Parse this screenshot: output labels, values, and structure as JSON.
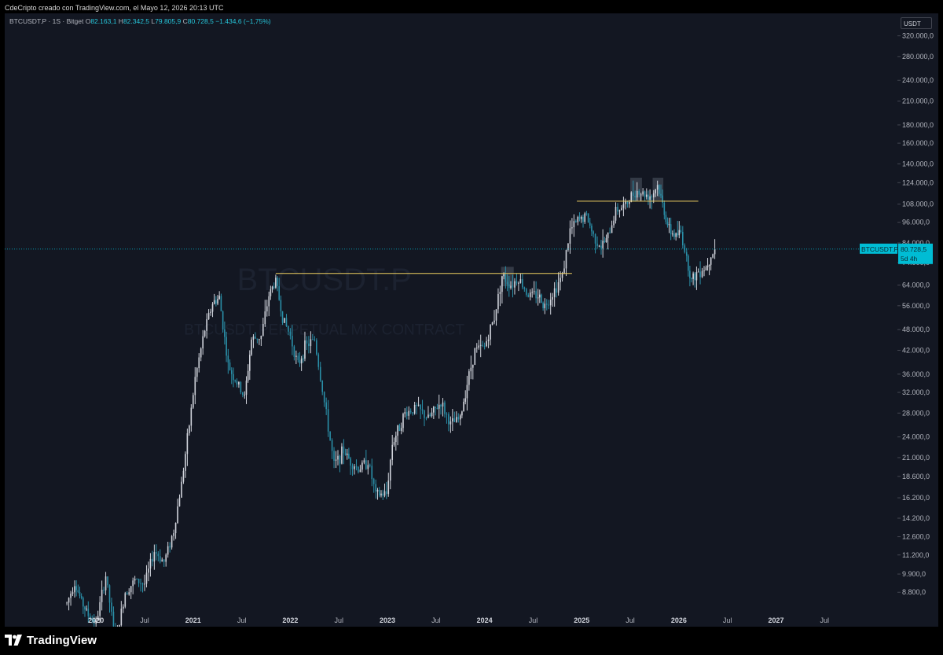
{
  "caption": "CdeCripto creado con TradingView.com, el Mayo 12, 2026 20:13 UTC",
  "legend": {
    "symbol_line": "BTCUSDT.P · 1S · Bitget",
    "open_label": "O",
    "open": "82.163,1",
    "high_label": "H",
    "high": "82.342,5",
    "low_label": "L",
    "low": "79.805,9",
    "close_label": "C",
    "close": "80.728,5",
    "change": "−1.434,6 (−1,75%)"
  },
  "currency": "USDT",
  "watermark": {
    "symbol": "BTCUSDT.P",
    "description": "BTCUSDT PERPETUAL MIX CONTRACT"
  },
  "price_scale": {
    "ticks": [
      "320.000,0",
      "280.000,0",
      "240.000,0",
      "210.000,0",
      "180.000,0",
      "160.000,0",
      "140.000,0",
      "124.000,0",
      "108.000,0",
      "96.000,0",
      "84.000,0",
      "74.000,0",
      "64.000,0",
      "56.000,0",
      "48.000,0",
      "42.000,0",
      "36.000,0",
      "32.000,0",
      "28.000,0",
      "24.000,0",
      "21.000,0",
      "18.600,0",
      "16.200,0",
      "14.200,0",
      "12.600,0",
      "11.200,0",
      "9.900,0",
      "8.800,0"
    ],
    "tick_values": [
      320000,
      280000,
      240000,
      210000,
      180000,
      160000,
      140000,
      124000,
      108000,
      96000,
      84000,
      74000,
      64000,
      56000,
      48000,
      42000,
      36000,
      32000,
      28000,
      24000,
      21000,
      18600,
      16200,
      14200,
      12600,
      11200,
      9900,
      8800
    ],
    "scale": "log",
    "range": [
      7800,
      370000
    ]
  },
  "time_scale": {
    "ticks": [
      {
        "label": "2020",
        "t": 2020.0,
        "year": true
      },
      {
        "label": "Jul",
        "t": 2020.5,
        "year": false
      },
      {
        "label": "2021",
        "t": 2021.0,
        "year": true
      },
      {
        "label": "Jul",
        "t": 2021.5,
        "year": false
      },
      {
        "label": "2022",
        "t": 2022.0,
        "year": true
      },
      {
        "label": "Jul",
        "t": 2022.5,
        "year": false
      },
      {
        "label": "2023",
        "t": 2023.0,
        "year": true
      },
      {
        "label": "Jul",
        "t": 2023.5,
        "year": false
      },
      {
        "label": "2024",
        "t": 2024.0,
        "year": true
      },
      {
        "label": "Jul",
        "t": 2024.5,
        "year": false
      },
      {
        "label": "2025",
        "t": 2025.0,
        "year": true
      },
      {
        "label": "Jul",
        "t": 2025.5,
        "year": false
      },
      {
        "label": "2026",
        "t": 2026.0,
        "year": true
      },
      {
        "label": "Jul",
        "t": 2026.5,
        "year": false
      },
      {
        "label": "2027",
        "t": 2027.0,
        "year": true
      },
      {
        "label": "Jul",
        "t": 2027.5,
        "year": false
      }
    ],
    "range": [
      2019.06,
      2028.25
    ]
  },
  "last_price": {
    "symbol": "BTCUSDT.P",
    "price": "80.728,5",
    "value": 80728.5,
    "countdown": "5d 4h",
    "color": "#00bcd4"
  },
  "colors": {
    "panel_bg": "#131722",
    "candle_up": "#d1d4dc",
    "candle_down": "#2a8fa8",
    "level_line": "#f0d060",
    "zone_fill": "#5d6673"
  },
  "chart_data": {
    "type": "candlestick",
    "timeframe": "1W",
    "scale": "log",
    "xlim": [
      2019.06,
      2028.25
    ],
    "ylim": [
      7800,
      370000
    ],
    "path": [
      [
        2019.7,
        8200
      ],
      [
        2019.78,
        9400
      ],
      [
        2019.85,
        8300
      ],
      [
        2019.92,
        7600
      ],
      [
        2020.0,
        7200
      ],
      [
        2020.1,
        9800
      ],
      [
        2020.2,
        6400
      ],
      [
        2020.3,
        8800
      ],
      [
        2020.4,
        9500
      ],
      [
        2020.5,
        9300
      ],
      [
        2020.6,
        11500
      ],
      [
        2020.7,
        10700
      ],
      [
        2020.8,
        13100
      ],
      [
        2020.88,
        17800
      ],
      [
        2020.96,
        26000
      ],
      [
        2021.02,
        35000
      ],
      [
        2021.12,
        48000
      ],
      [
        2021.2,
        57000
      ],
      [
        2021.27,
        59000
      ],
      [
        2021.36,
        38000
      ],
      [
        2021.45,
        34000
      ],
      [
        2021.53,
        31000
      ],
      [
        2021.6,
        45000
      ],
      [
        2021.7,
        46000
      ],
      [
        2021.78,
        60000
      ],
      [
        2021.85,
        66000
      ],
      [
        2021.92,
        52000
      ],
      [
        2022.0,
        46000
      ],
      [
        2022.08,
        38000
      ],
      [
        2022.15,
        43000
      ],
      [
        2022.25,
        45000
      ],
      [
        2022.35,
        30000
      ],
      [
        2022.45,
        20000
      ],
      [
        2022.55,
        22000
      ],
      [
        2022.62,
        20500
      ],
      [
        2022.7,
        19500
      ],
      [
        2022.8,
        20500
      ],
      [
        2022.88,
        16500
      ],
      [
        2022.99,
        16600
      ],
      [
        2023.05,
        23000
      ],
      [
        2023.18,
        28000
      ],
      [
        2023.3,
        29000
      ],
      [
        2023.42,
        27000
      ],
      [
        2023.55,
        30000
      ],
      [
        2023.65,
        26000
      ],
      [
        2023.75,
        27000
      ],
      [
        2023.82,
        34000
      ],
      [
        2023.9,
        42000
      ],
      [
        2024.0,
        43000
      ],
      [
        2024.1,
        52000
      ],
      [
        2024.18,
        68000
      ],
      [
        2024.27,
        64000
      ],
      [
        2024.35,
        67000
      ],
      [
        2024.45,
        60000
      ],
      [
        2024.55,
        60000
      ],
      [
        2024.62,
        56000
      ],
      [
        2024.72,
        62000
      ],
      [
        2024.8,
        68000
      ],
      [
        2024.88,
        91000
      ],
      [
        2024.96,
        97000
      ],
      [
        2025.05,
        100000
      ],
      [
        2025.12,
        88000
      ],
      [
        2025.2,
        82000
      ],
      [
        2025.27,
        87000
      ],
      [
        2025.35,
        104000
      ],
      [
        2025.45,
        107000
      ],
      [
        2025.55,
        118000
      ],
      [
        2025.65,
        115000
      ],
      [
        2025.72,
        114000
      ],
      [
        2025.78,
        122000
      ],
      [
        2025.85,
        103000
      ],
      [
        2025.9,
        91000
      ],
      [
        2025.97,
        88000
      ],
      [
        2026.02,
        90000
      ],
      [
        2026.08,
        76000
      ],
      [
        2026.13,
        66000
      ],
      [
        2026.2,
        70000
      ],
      [
        2026.28,
        72000
      ],
      [
        2026.33,
        78000
      ],
      [
        2026.37,
        80728.5
      ]
    ],
    "levels": [
      {
        "price": 69000,
        "from": 2021.85,
        "to": 2024.9
      },
      {
        "price": 110000,
        "from": 2024.95,
        "to": 2026.2
      }
    ],
    "zones": [
      {
        "from": 2024.17,
        "to": 2024.3,
        "top": 72000,
        "bottom": 63500
      },
      {
        "from": 2025.5,
        "to": 2025.62,
        "top": 128000,
        "bottom": 110500
      },
      {
        "from": 2025.73,
        "to": 2025.84,
        "top": 128000,
        "bottom": 110500
      }
    ],
    "last_price_line": 80728.5
  },
  "footer": {
    "brand": "TradingView"
  }
}
